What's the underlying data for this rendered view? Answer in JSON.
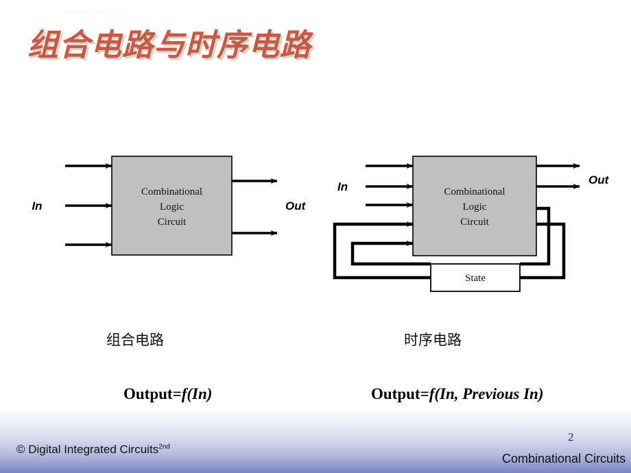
{
  "slide": {
    "title": "组合电路与时序电路",
    "title_color": "#c05c4a",
    "title_shadow_color": "#eccfc4",
    "background_color": "#ffffff"
  },
  "combinational": {
    "block_line1": "Combinational",
    "block_line2": "Logic",
    "block_line3": "Circuit",
    "block_fill": "#c0c0c0",
    "in_label": "In",
    "out_label": "Out",
    "input_arrow_count": 3,
    "output_arrow_count": 2,
    "caption": "组合电路",
    "formula_lhs": "Output",
    "formula_eq": "=",
    "formula_f": "f",
    "formula_args": "(In)"
  },
  "sequential": {
    "block_line1": "Combinational",
    "block_line2": "Logic",
    "block_line3": "Circuit",
    "block_fill": "#c0c0c0",
    "state_label": "State",
    "state_fill": "#ffffff",
    "in_label": "In",
    "out_label": "Out",
    "input_arrow_count": 3,
    "feedback_arrow_count": 2,
    "output_arrow_count": 2,
    "caption": "时序电路",
    "formula_lhs": "Output",
    "formula_eq": "=",
    "formula_f": "f",
    "formula_args": "(In, Previous In)"
  },
  "footer": {
    "copyright": "© Digital Integrated  Circuits",
    "edition": "2nd",
    "page_number": "2",
    "section": "Combinational  Circuits",
    "band_top_color": "#fbfbfd",
    "band_bottom_color": "#7a83c2",
    "page_number_color": "#26268c"
  }
}
